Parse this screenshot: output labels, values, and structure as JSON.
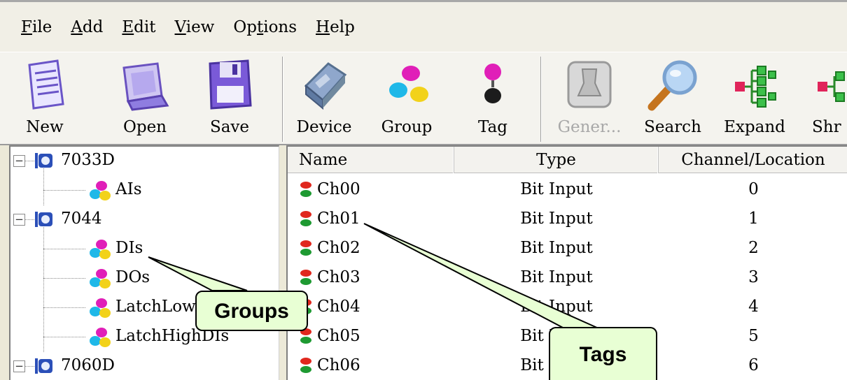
{
  "menu": [
    {
      "mnemonic": "F",
      "rest": "ile"
    },
    {
      "mnemonic": "A",
      "rest": "dd"
    },
    {
      "mnemonic": "E",
      "rest": "dit"
    },
    {
      "mnemonic": "V",
      "rest": "iew"
    },
    {
      "pre": "Op",
      "mnemonic": "t",
      "rest": "ions"
    },
    {
      "mnemonic": "H",
      "rest": "elp"
    }
  ],
  "toolbar": {
    "new": "New",
    "open": "Open",
    "save": "Save",
    "device": "Device",
    "group": "Group",
    "tag": "Tag",
    "gener": "Gener...",
    "search": "Search",
    "expand": "Expand",
    "shrink": "Shr"
  },
  "tree": {
    "device1": "7033D",
    "group_ais": "AIs",
    "device2": "7044",
    "group_dis": "DIs",
    "group_dos": "DOs",
    "group_latchlow": "LatchLowDIs",
    "group_latchhigh": "LatchHighDIs",
    "device3": "7060D",
    "expander_symbol": "−"
  },
  "list": {
    "columns": {
      "name": "Name",
      "type": "Type",
      "channel": "Channel/Location"
    },
    "rows": [
      {
        "name": "Ch00",
        "type": "Bit Input",
        "channel": "0"
      },
      {
        "name": "Ch01",
        "type": "Bit Input",
        "channel": "1"
      },
      {
        "name": "Ch02",
        "type": "Bit Input",
        "channel": "2"
      },
      {
        "name": "Ch03",
        "type": "Bit Input",
        "channel": "3"
      },
      {
        "name": "Ch04",
        "type": "Bit Input",
        "channel": "4"
      },
      {
        "name": "Ch05",
        "type": "Bit Input",
        "channel": "5"
      },
      {
        "name": "Ch06",
        "type": "Bit Input",
        "channel": "6"
      }
    ]
  },
  "callouts": {
    "groups": "Groups",
    "tags": "Tags"
  },
  "colors": {
    "callout_fill": "#e8ffd4",
    "tag_red": "#e0281e",
    "tag_green": "#1e9a32",
    "device_blue": "#2b4fb8"
  }
}
